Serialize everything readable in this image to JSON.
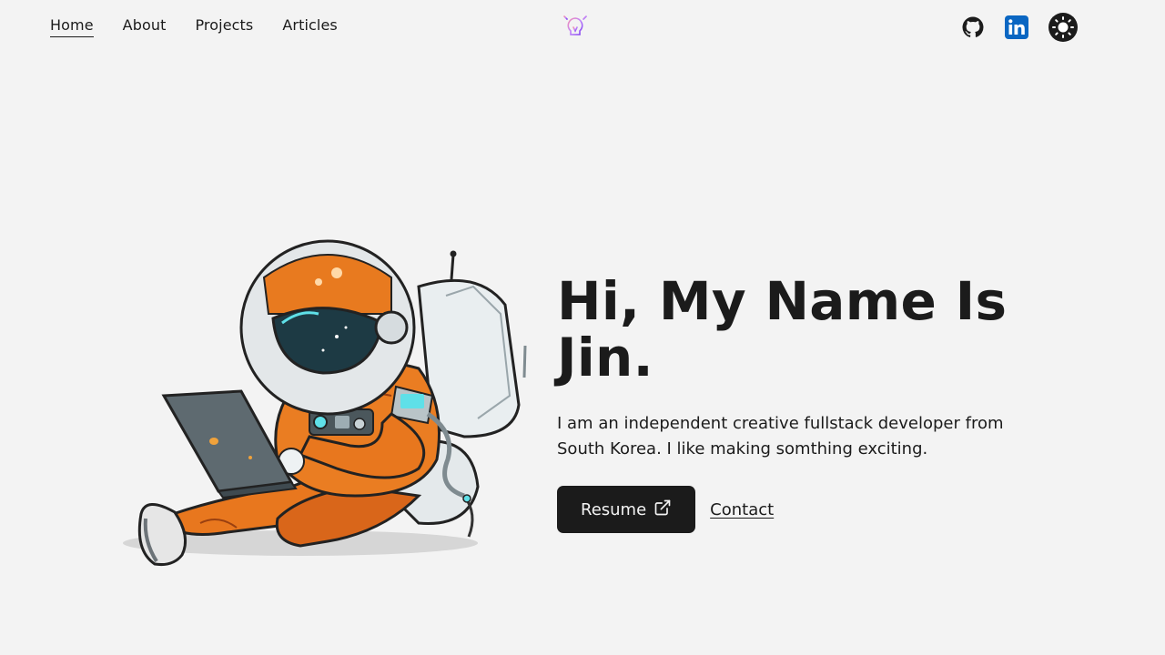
{
  "nav": {
    "links": [
      {
        "label": "Home",
        "active": true
      },
      {
        "label": "About",
        "active": false
      },
      {
        "label": "Projects",
        "active": false
      },
      {
        "label": "Articles",
        "active": false
      }
    ]
  },
  "logo": {
    "icon": "lightbulb-icon"
  },
  "socials": [
    {
      "name": "github",
      "icon": "github-icon"
    },
    {
      "name": "linkedin",
      "icon": "linkedin-icon",
      "color": "#0a66c2"
    },
    {
      "name": "theme-toggle",
      "icon": "sun-icon"
    }
  ],
  "hero": {
    "heading_line1": "Hi, My Name Is",
    "heading_line2": "Jin.",
    "description": "I am an independent creative fullstack developer from South Korea. I like making somthing exciting.",
    "resume_label": "Resume",
    "contact_label": "Contact"
  },
  "colors": {
    "background": "#f3f3f3",
    "text": "#1b1b1b",
    "accent": "#1b1b1b",
    "suit_orange": "#e8771e"
  }
}
